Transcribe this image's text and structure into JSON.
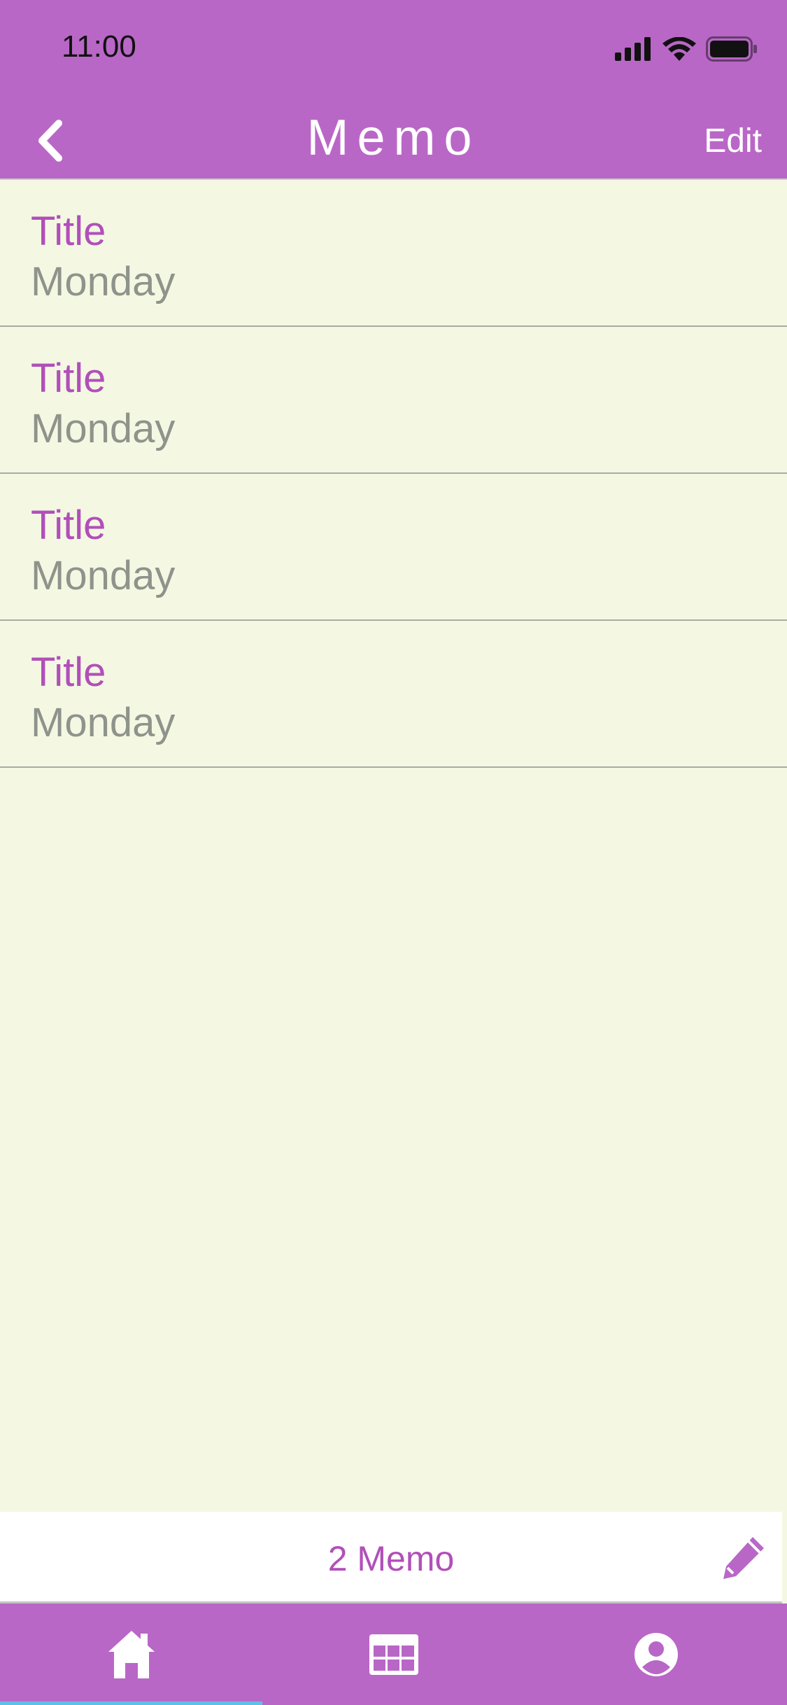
{
  "status": {
    "time": "11:00"
  },
  "nav": {
    "title": "Memo",
    "edit_label": "Edit"
  },
  "memos": [
    {
      "title": "Title",
      "subtitle": "Monday"
    },
    {
      "title": "Title",
      "subtitle": "Monday"
    },
    {
      "title": "Title",
      "subtitle": "Monday"
    },
    {
      "title": "Title",
      "subtitle": "Monday"
    }
  ],
  "toolbar": {
    "count_label": "2 Memo"
  },
  "tabs": [
    {
      "icon": "home-icon"
    },
    {
      "icon": "calendar-icon"
    },
    {
      "icon": "account-icon"
    }
  ],
  "colors": {
    "accent": "#B967C7",
    "text_accent": "#B14FB9",
    "background": "#F4F8E3",
    "subtitle": "#8E938B"
  }
}
